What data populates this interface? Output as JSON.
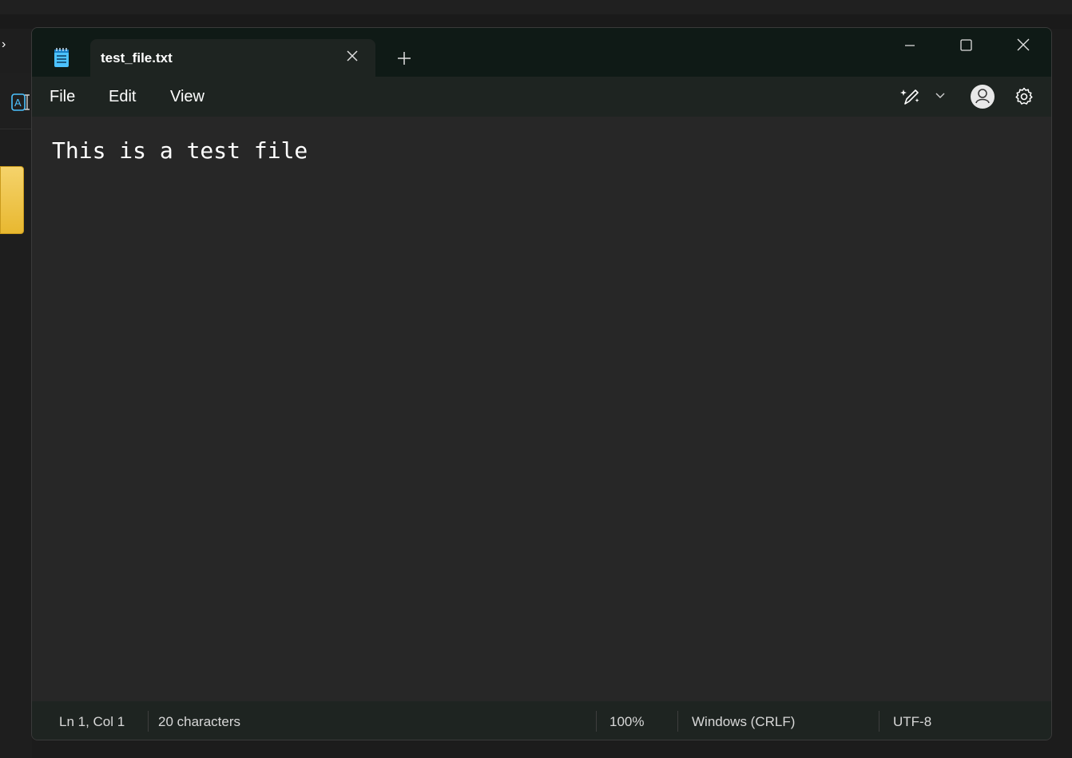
{
  "background": {
    "chevron": "›"
  },
  "tab": {
    "title": "test_file.txt"
  },
  "menu": {
    "file": "File",
    "edit": "Edit",
    "view": "View"
  },
  "editor": {
    "content": "This is a test file"
  },
  "status": {
    "position": "Ln 1, Col 1",
    "characters": "20 characters",
    "zoom": "100%",
    "line_ending": "Windows (CRLF)",
    "encoding": "UTF-8"
  },
  "icons": {
    "app": "notepad-icon",
    "tab_close": "close-icon",
    "new_tab": "plus-icon",
    "minimize": "minimize-icon",
    "maximize": "maximize-icon",
    "close": "close-icon",
    "copilot": "copilot-pen-icon",
    "chevron": "chevron-down-icon",
    "profile": "avatar-icon",
    "settings": "gear-icon"
  },
  "colors": {
    "titlebar": "#0f1a16",
    "tab": "#1e2421",
    "editor": "#272727",
    "app_icon": "#4cc2ff"
  }
}
